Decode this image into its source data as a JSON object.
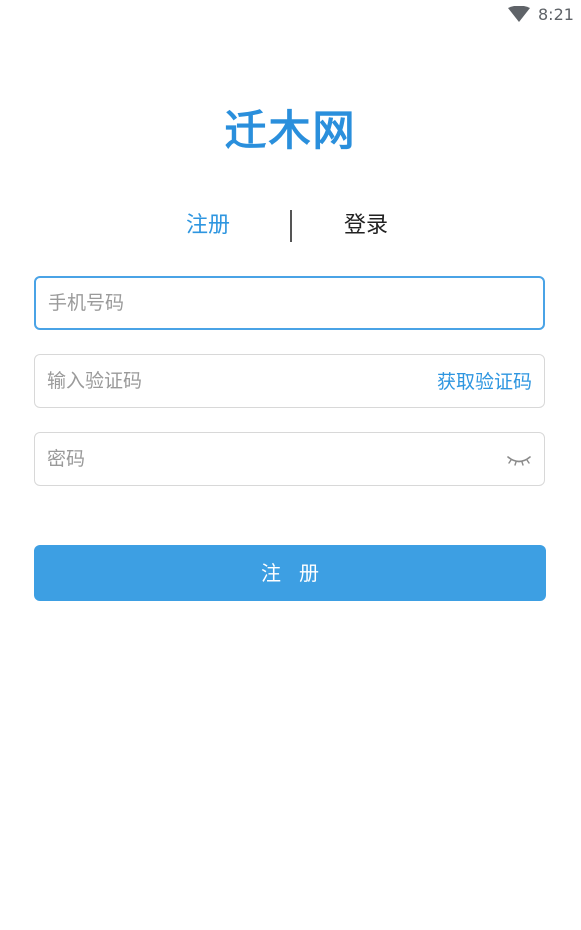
{
  "status_bar": {
    "time": "8:21",
    "wifi_icon": "wifi-icon"
  },
  "app": {
    "logo_text": "迁木网",
    "accent_color": "#2e96e0",
    "button_color": "#3d9fe3"
  },
  "tabs": {
    "register_label": "注册",
    "login_label": "登录",
    "active": "register"
  },
  "form": {
    "phone_placeholder": "手机号码",
    "phone_value": "",
    "code_placeholder": "输入验证码",
    "code_value": "",
    "get_code_label": "获取验证码",
    "password_placeholder": "密码",
    "password_value": "",
    "password_toggle_icon": "eye-closed-icon",
    "submit_label": "注册"
  }
}
